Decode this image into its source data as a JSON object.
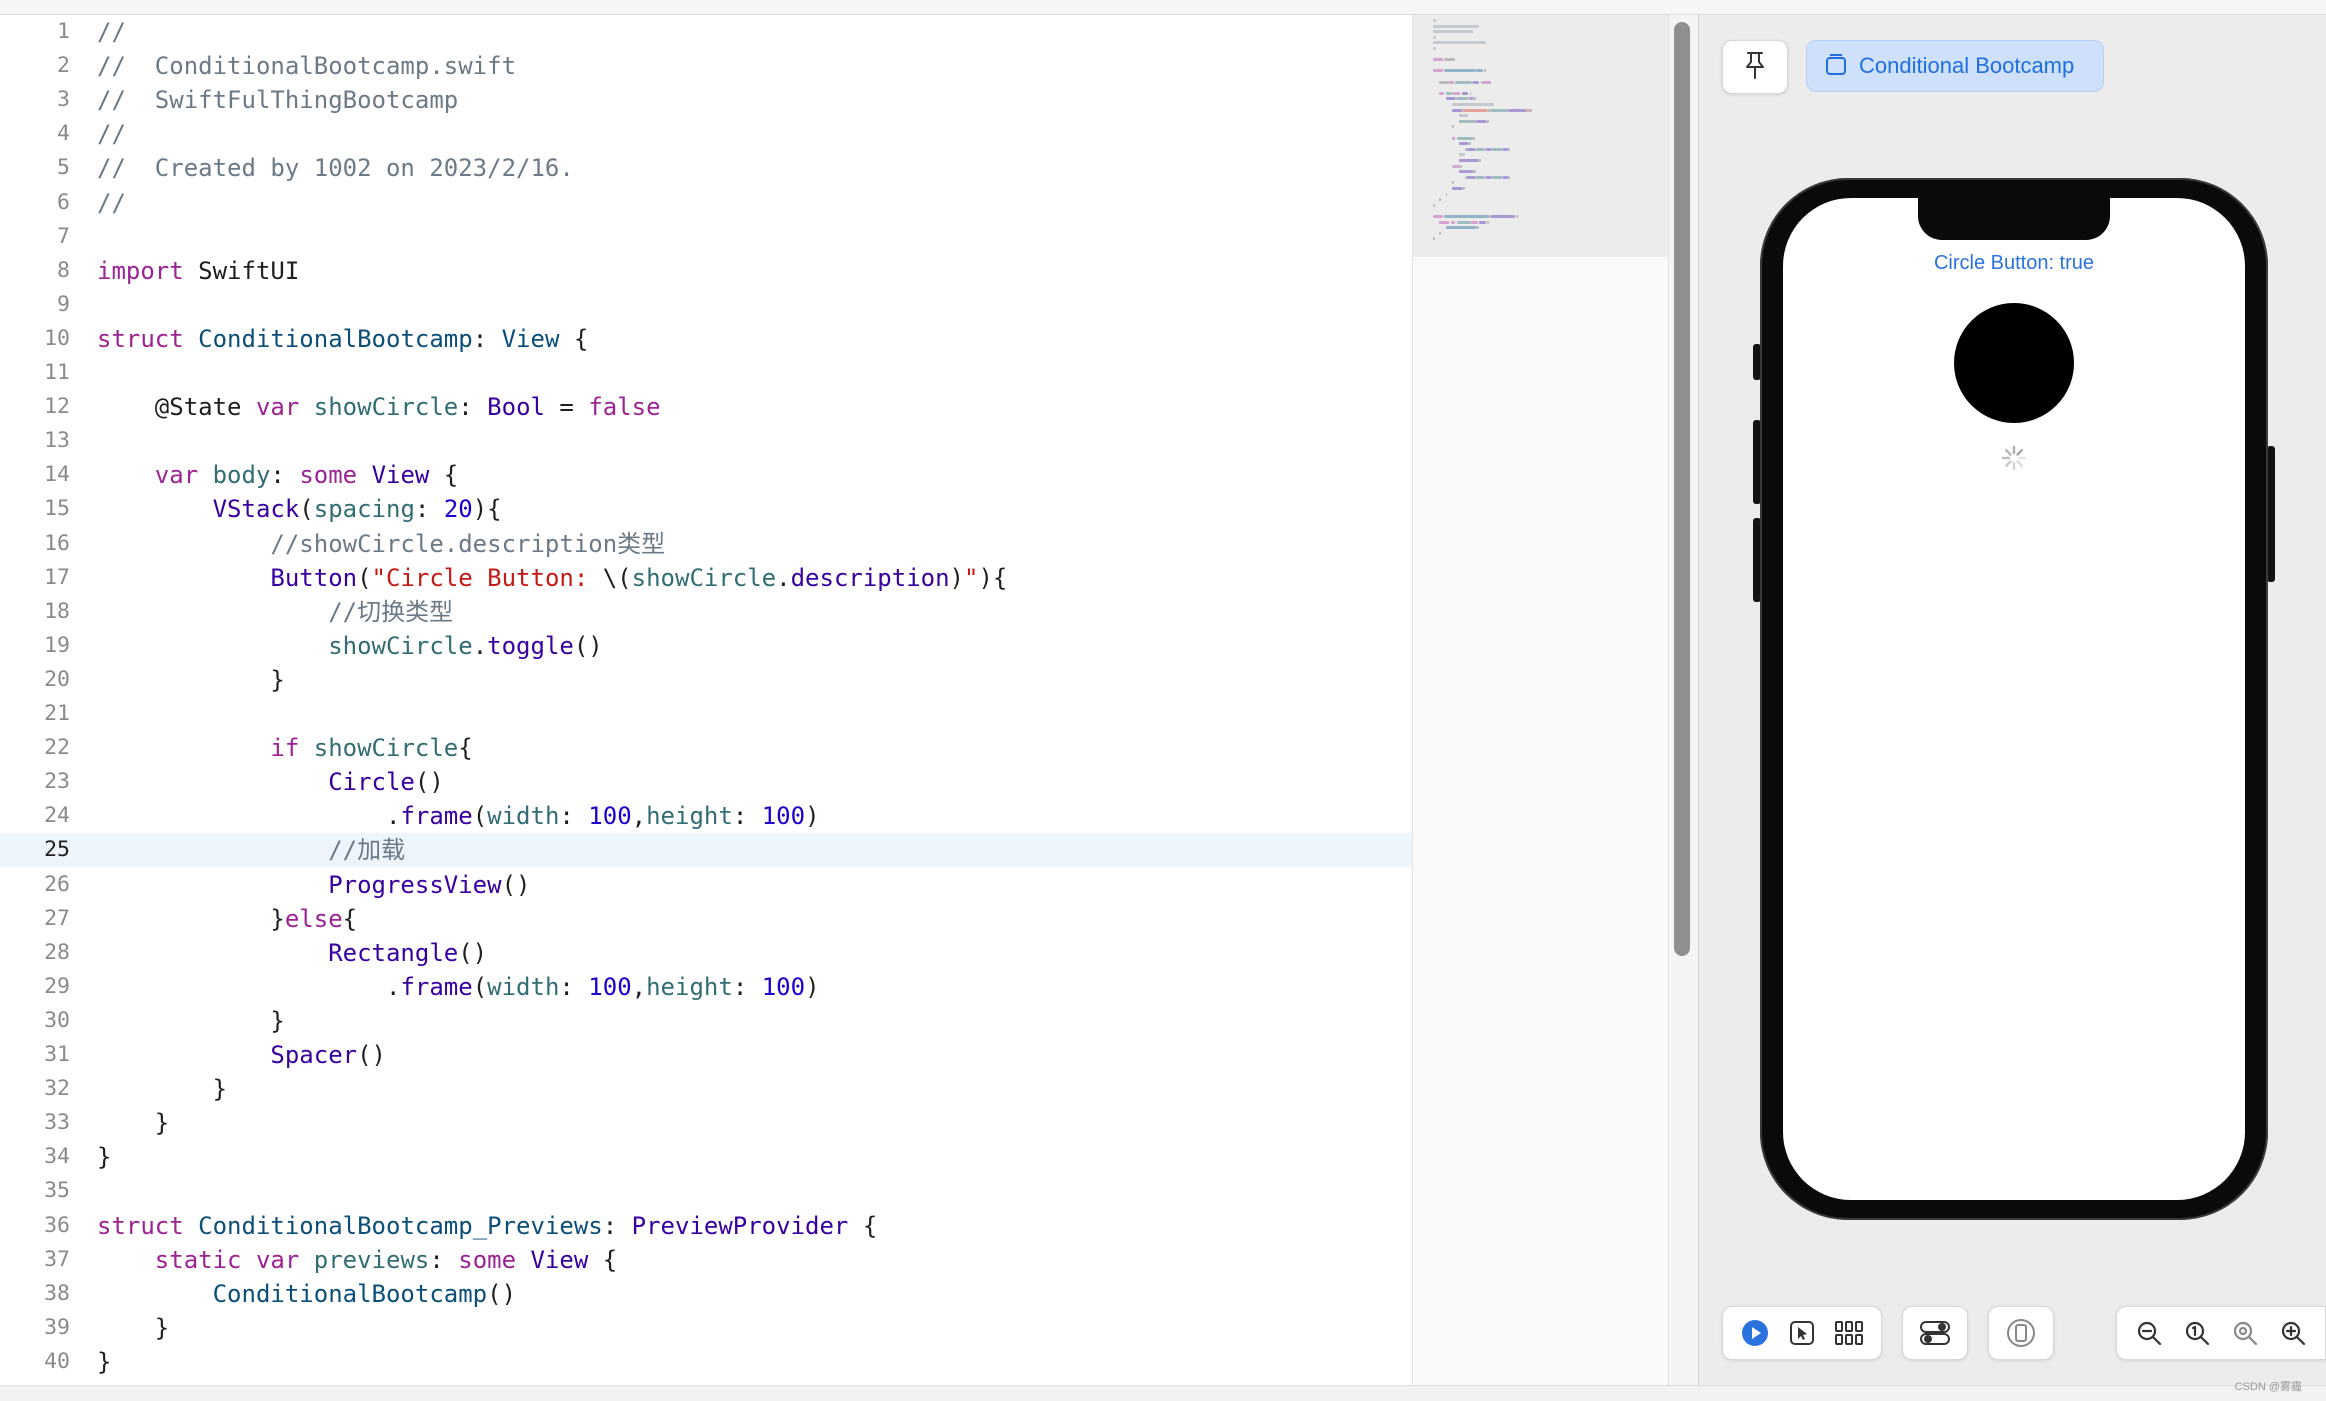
{
  "editor": {
    "current_line": 25,
    "lines": [
      {
        "n": "1",
        "tokens": [
          [
            "c",
            "//"
          ]
        ]
      },
      {
        "n": "2",
        "tokens": [
          [
            "c",
            "//  ConditionalBootcamp.swift"
          ]
        ]
      },
      {
        "n": "3",
        "tokens": [
          [
            "c",
            "//  SwiftFulThingBootcamp"
          ]
        ]
      },
      {
        "n": "4",
        "tokens": [
          [
            "c",
            "//"
          ]
        ]
      },
      {
        "n": "5",
        "tokens": [
          [
            "c",
            "//  Created by 1002 on 2023/2/16."
          ]
        ]
      },
      {
        "n": "6",
        "tokens": [
          [
            "c",
            "//"
          ]
        ]
      },
      {
        "n": "7",
        "tokens": []
      },
      {
        "n": "8",
        "tokens": [
          [
            "k",
            "import"
          ],
          [
            "p",
            " SwiftUI"
          ]
        ]
      },
      {
        "n": "9",
        "tokens": []
      },
      {
        "n": "10",
        "tokens": [
          [
            "k",
            "struct"
          ],
          [
            "p",
            " "
          ],
          [
            "t",
            "ConditionalBootcamp"
          ],
          [
            "p",
            ": "
          ],
          [
            "t",
            "View"
          ],
          [
            "p",
            " {"
          ]
        ]
      },
      {
        "n": "11",
        "tokens": []
      },
      {
        "n": "12",
        "tokens": [
          [
            "p",
            "    @State "
          ],
          [
            "k",
            "var"
          ],
          [
            "p",
            " "
          ],
          [
            "v",
            "showCircle"
          ],
          [
            "p",
            ": "
          ],
          [
            "f",
            "Bool"
          ],
          [
            "p",
            " = "
          ],
          [
            "k",
            "false"
          ]
        ]
      },
      {
        "n": "13",
        "tokens": []
      },
      {
        "n": "14",
        "tokens": [
          [
            "p",
            "    "
          ],
          [
            "k",
            "var"
          ],
          [
            "p",
            " "
          ],
          [
            "v",
            "body"
          ],
          [
            "p",
            ": "
          ],
          [
            "k",
            "some"
          ],
          [
            "p",
            " "
          ],
          [
            "f",
            "View"
          ],
          [
            "p",
            " {"
          ]
        ]
      },
      {
        "n": "15",
        "tokens": [
          [
            "p",
            "        "
          ],
          [
            "f",
            "VStack"
          ],
          [
            "p",
            "("
          ],
          [
            "v",
            "spacing"
          ],
          [
            "p",
            ": "
          ],
          [
            "n",
            "20"
          ],
          [
            "p",
            "){"
          ]
        ]
      },
      {
        "n": "16",
        "tokens": [
          [
            "c",
            "            //showCircle.description类型"
          ]
        ]
      },
      {
        "n": "17",
        "tokens": [
          [
            "p",
            "            "
          ],
          [
            "f",
            "Button"
          ],
          [
            "p",
            "("
          ],
          [
            "s",
            "\"Circle Button: "
          ],
          [
            "p",
            "\\("
          ],
          [
            "v",
            "showCircle"
          ],
          [
            "p",
            "."
          ],
          [
            "f",
            "description"
          ],
          [
            "p",
            ")"
          ],
          [
            "s",
            "\""
          ],
          [
            "p",
            "){"
          ]
        ]
      },
      {
        "n": "18",
        "tokens": [
          [
            "c",
            "                //切换类型"
          ]
        ]
      },
      {
        "n": "19",
        "tokens": [
          [
            "p",
            "                "
          ],
          [
            "v",
            "showCircle"
          ],
          [
            "p",
            "."
          ],
          [
            "f",
            "toggle"
          ],
          [
            "p",
            "()"
          ]
        ]
      },
      {
        "n": "20",
        "tokens": [
          [
            "p",
            "            }"
          ]
        ]
      },
      {
        "n": "21",
        "tokens": []
      },
      {
        "n": "22",
        "tokens": [
          [
            "p",
            "            "
          ],
          [
            "k",
            "if"
          ],
          [
            "p",
            " "
          ],
          [
            "v",
            "showCircle"
          ],
          [
            "p",
            "{"
          ]
        ]
      },
      {
        "n": "23",
        "tokens": [
          [
            "p",
            "                "
          ],
          [
            "f",
            "Circle"
          ],
          [
            "p",
            "()"
          ]
        ]
      },
      {
        "n": "24",
        "tokens": [
          [
            "p",
            "                    ."
          ],
          [
            "f",
            "frame"
          ],
          [
            "p",
            "("
          ],
          [
            "v",
            "width"
          ],
          [
            "p",
            ": "
          ],
          [
            "n",
            "100"
          ],
          [
            "p",
            ","
          ],
          [
            "v",
            "height"
          ],
          [
            "p",
            ": "
          ],
          [
            "n",
            "100"
          ],
          [
            "p",
            ")"
          ]
        ]
      },
      {
        "n": "25",
        "tokens": [
          [
            "c",
            "                //加载"
          ]
        ]
      },
      {
        "n": "26",
        "tokens": [
          [
            "p",
            "                "
          ],
          [
            "f",
            "ProgressView"
          ],
          [
            "p",
            "()"
          ]
        ]
      },
      {
        "n": "27",
        "tokens": [
          [
            "p",
            "            }"
          ],
          [
            "k",
            "else"
          ],
          [
            "p",
            "{"
          ]
        ]
      },
      {
        "n": "28",
        "tokens": [
          [
            "p",
            "                "
          ],
          [
            "f",
            "Rectangle"
          ],
          [
            "p",
            "()"
          ]
        ]
      },
      {
        "n": "29",
        "tokens": [
          [
            "p",
            "                    ."
          ],
          [
            "f",
            "frame"
          ],
          [
            "p",
            "("
          ],
          [
            "v",
            "width"
          ],
          [
            "p",
            ": "
          ],
          [
            "n",
            "100"
          ],
          [
            "p",
            ","
          ],
          [
            "v",
            "height"
          ],
          [
            "p",
            ": "
          ],
          [
            "n",
            "100"
          ],
          [
            "p",
            ")"
          ]
        ]
      },
      {
        "n": "30",
        "tokens": [
          [
            "p",
            "            }"
          ]
        ]
      },
      {
        "n": "31",
        "tokens": [
          [
            "p",
            "            "
          ],
          [
            "f",
            "Spacer"
          ],
          [
            "p",
            "()"
          ]
        ]
      },
      {
        "n": "32",
        "tokens": [
          [
            "p",
            "        }"
          ]
        ]
      },
      {
        "n": "33",
        "tokens": [
          [
            "p",
            "    }"
          ]
        ]
      },
      {
        "n": "34",
        "tokens": [
          [
            "p",
            "}"
          ]
        ]
      },
      {
        "n": "35",
        "tokens": []
      },
      {
        "n": "36",
        "tokens": [
          [
            "k",
            "struct"
          ],
          [
            "p",
            " "
          ],
          [
            "t",
            "ConditionalBootcamp_Previews"
          ],
          [
            "p",
            ": "
          ],
          [
            "f",
            "PreviewProvider"
          ],
          [
            "p",
            " {"
          ]
        ]
      },
      {
        "n": "37",
        "tokens": [
          [
            "p",
            "    "
          ],
          [
            "k",
            "static"
          ],
          [
            "p",
            " "
          ],
          [
            "k",
            "var"
          ],
          [
            "p",
            " "
          ],
          [
            "v",
            "previews"
          ],
          [
            "p",
            ": "
          ],
          [
            "k",
            "some"
          ],
          [
            "p",
            " "
          ],
          [
            "f",
            "View"
          ],
          [
            "p",
            " {"
          ]
        ]
      },
      {
        "n": "38",
        "tokens": [
          [
            "p",
            "        "
          ],
          [
            "t",
            "ConditionalBootcamp"
          ],
          [
            "p",
            "()"
          ]
        ]
      },
      {
        "n": "39",
        "tokens": [
          [
            "p",
            "    }"
          ]
        ]
      },
      {
        "n": "40",
        "tokens": [
          [
            "p",
            "}"
          ]
        ]
      }
    ]
  },
  "preview": {
    "pin_icon": "pin-icon",
    "chip_icon": "preview-layer-icon",
    "chip_label": "Conditional Bootcamp",
    "app_button_label": "Circle Button: true",
    "toolbar": {
      "live_icon": "play-icon",
      "select_icon": "cursor-select-icon",
      "variants_icon": "grid-variants-icon",
      "settings_icon": "device-settings-toggle-icon",
      "device_icon": "device-icon",
      "zoom_out_icon": "zoom-out-icon",
      "zoom_actual_icon": "zoom-100-icon",
      "zoom_fit_icon": "zoom-fit-icon",
      "zoom_in_icon": "zoom-in-icon"
    },
    "accent_color": "#2a72e0"
  },
  "watermark": "CSDN @雾霾"
}
